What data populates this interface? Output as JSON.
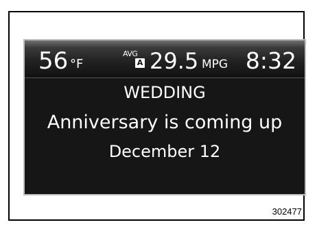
{
  "status_bar": {
    "temperature": "56",
    "temperature_unit": "°F",
    "avg_label": "AVG",
    "avg_badge": "A",
    "fuel_economy": "29.5",
    "fuel_economy_unit": "MPG",
    "clock": "8:32"
  },
  "message": {
    "title": "WEDDING",
    "line": "Anniversary is coming up",
    "date": "December 12"
  },
  "figure_number": "302477",
  "colors": {
    "screen_background": "#161616",
    "text": "#ffffff"
  }
}
